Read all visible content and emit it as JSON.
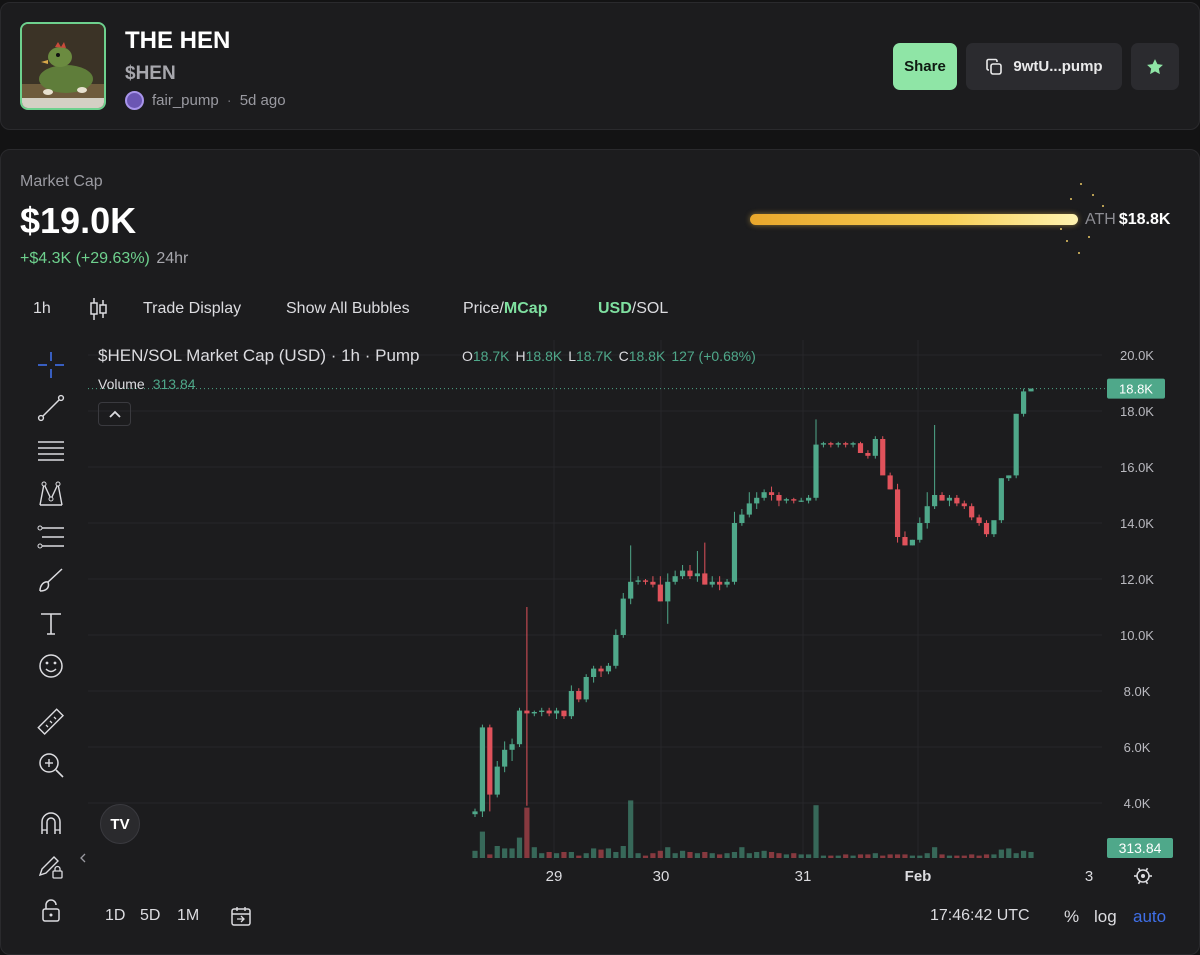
{
  "token": {
    "name": "THE HEN",
    "ticker": "$HEN",
    "creator": "fair_pump",
    "age": "5d ago"
  },
  "actions": {
    "share_label": "Share",
    "address_label": "9wtU...pump"
  },
  "market": {
    "label": "Market Cap",
    "value": "$19.0K",
    "change": "+$4.3K (+29.63%)",
    "change_period": "24hr",
    "ath_label": "ATH",
    "ath_value": "$18.8K"
  },
  "toolbar": {
    "interval": "1h",
    "trade_display": "Trade Display",
    "show_bubbles": "Show All Bubbles",
    "price_label": "Price/",
    "mcap_label": "MCap",
    "usd_label": "USD",
    "sol_label": "/SOL"
  },
  "chart_header": {
    "title": "$HEN/SOL Market Cap (USD) · 1h · Pump",
    "o_label": "O",
    "o_value": "18.7K",
    "h_label": "H",
    "h_value": "18.8K",
    "l_label": "L",
    "l_value": "18.7K",
    "c_label": "C",
    "c_value": "18.8K",
    "change": "127 (+0.68%)",
    "volume_label": "Volume",
    "volume_value": "313.84"
  },
  "bottom": {
    "ranges": [
      "1D",
      "5D",
      "1M"
    ],
    "time": "17:46:42 UTC",
    "percent": "%",
    "log": "log",
    "auto": "auto"
  },
  "colors": {
    "up": "#4fa88a",
    "down": "#e0525b",
    "accent": "#8fe5a6",
    "auto": "#3f6fe8"
  },
  "chart_data": {
    "type": "candlestick",
    "title": "$HEN/SOL Market Cap (USD) · 1h · Pump",
    "y_ticks": [
      "20.0K",
      "18.0K",
      "16.0K",
      "14.0K",
      "12.0K",
      "10.0K",
      "8.0K",
      "6.0K",
      "4.0K"
    ],
    "ylim": [
      3000,
      20000
    ],
    "x_ticks": [
      "29",
      "30",
      "31",
      "Feb",
      "3"
    ],
    "last_price_label": "18.8K",
    "last_volume_label": "313.84",
    "candles": [
      [
        3600,
        3800,
        3500,
        3700
      ],
      [
        3700,
        6800,
        3500,
        6700
      ],
      [
        6700,
        6800,
        3700,
        4300
      ],
      [
        4300,
        5500,
        4200,
        5300
      ],
      [
        5300,
        6200,
        5100,
        5900
      ],
      [
        5900,
        6300,
        5500,
        6100
      ],
      [
        6100,
        7400,
        6000,
        7300
      ],
      [
        7300,
        11000,
        3900,
        7200
      ],
      [
        7200,
        7300,
        7100,
        7250
      ],
      [
        7250,
        7400,
        7100,
        7300
      ],
      [
        7300,
        7400,
        7100,
        7200
      ],
      [
        7200,
        7400,
        7000,
        7300
      ],
      [
        7300,
        7300,
        7000,
        7100
      ],
      [
        7100,
        8200,
        7000,
        8000
      ],
      [
        8000,
        8100,
        7600,
        7700
      ],
      [
        7700,
        8600,
        7600,
        8500
      ],
      [
        8500,
        8900,
        8300,
        8800
      ],
      [
        8800,
        8900,
        8500,
        8700
      ],
      [
        8700,
        9000,
        8600,
        8900
      ],
      [
        8900,
        10200,
        8800,
        10000
      ],
      [
        10000,
        11500,
        9900,
        11300
      ],
      [
        11300,
        13200,
        11100,
        11900
      ],
      [
        11900,
        12100,
        11800,
        11950
      ],
      [
        11950,
        12000,
        11800,
        11900
      ],
      [
        11900,
        12100,
        11700,
        11800
      ],
      [
        11800,
        12100,
        11200,
        11200
      ],
      [
        11200,
        12200,
        10400,
        11900
      ],
      [
        11900,
        12300,
        11800,
        12100
      ],
      [
        12100,
        12500,
        12000,
        12300
      ],
      [
        12300,
        12500,
        12000,
        12100
      ],
      [
        12100,
        13000,
        11900,
        12200
      ],
      [
        12200,
        13300,
        11800,
        11800
      ],
      [
        11800,
        12100,
        11700,
        11900
      ],
      [
        11900,
        12100,
        11600,
        11800
      ],
      [
        11800,
        12000,
        11700,
        11900
      ],
      [
        11900,
        14400,
        11800,
        14000
      ],
      [
        14000,
        14500,
        13900,
        14300
      ],
      [
        14300,
        15100,
        14200,
        14700
      ],
      [
        14700,
        15100,
        14500,
        14900
      ],
      [
        14900,
        15200,
        14800,
        15100
      ],
      [
        15100,
        15300,
        14800,
        15000
      ],
      [
        15000,
        15100,
        14600,
        14800
      ],
      [
        14800,
        14900,
        14700,
        14850
      ],
      [
        14850,
        14900,
        14700,
        14800
      ],
      [
        14800,
        14900,
        14750,
        14800
      ],
      [
        14800,
        15000,
        14700,
        14900
      ],
      [
        14900,
        17700,
        14800,
        16800
      ],
      [
        16800,
        16900,
        16700,
        16850
      ],
      [
        16850,
        16900,
        16700,
        16800
      ],
      [
        16800,
        16900,
        16700,
        16850
      ],
      [
        16850,
        16900,
        16700,
        16800
      ],
      [
        16800,
        16900,
        16700,
        16850
      ],
      [
        16850,
        16900,
        16600,
        16500
      ],
      [
        16500,
        16600,
        16300,
        16400
      ],
      [
        16400,
        17100,
        16300,
        17000
      ],
      [
        17000,
        17100,
        15800,
        15700
      ],
      [
        15700,
        15800,
        15200,
        15200
      ],
      [
        15200,
        15400,
        13300,
        13500
      ],
      [
        13500,
        13700,
        13200,
        13200
      ],
      [
        13200,
        13400,
        13200,
        13400
      ],
      [
        13400,
        14200,
        13300,
        14000
      ],
      [
        14000,
        15100,
        13800,
        14600
      ],
      [
        14600,
        17500,
        14500,
        15000
      ],
      [
        15000,
        15100,
        14800,
        14800
      ],
      [
        14800,
        15000,
        14600,
        14900
      ],
      [
        14900,
        15000,
        14600,
        14700
      ],
      [
        14700,
        14800,
        14500,
        14600
      ],
      [
        14600,
        14700,
        14100,
        14200
      ],
      [
        14200,
        14300,
        13900,
        14000
      ],
      [
        14000,
        14100,
        13500,
        13600
      ],
      [
        13600,
        14000,
        13500,
        14100
      ],
      [
        14100,
        15600,
        14000,
        15600
      ],
      [
        15600,
        15700,
        15500,
        15700
      ],
      [
        15700,
        17900,
        15600,
        17900
      ],
      [
        17900,
        18800,
        17800,
        18700
      ],
      [
        18700,
        18800,
        18700,
        18800
      ]
    ],
    "volumes": [
      30,
      110,
      15,
      50,
      40,
      40,
      85,
      210,
      45,
      20,
      25,
      20,
      25,
      25,
      10,
      20,
      40,
      35,
      40,
      25,
      50,
      240,
      20,
      10,
      20,
      30,
      45,
      20,
      30,
      25,
      20,
      25,
      20,
      15,
      20,
      25,
      45,
      20,
      25,
      30,
      25,
      20,
      15,
      20,
      15,
      15,
      220,
      10,
      10,
      10,
      15,
      10,
      15,
      15,
      20,
      10,
      15,
      15,
      15,
      10,
      10,
      20,
      45,
      15,
      10,
      10,
      10,
      15,
      10,
      15,
      15,
      35,
      40,
      20,
      30,
      25
    ]
  }
}
